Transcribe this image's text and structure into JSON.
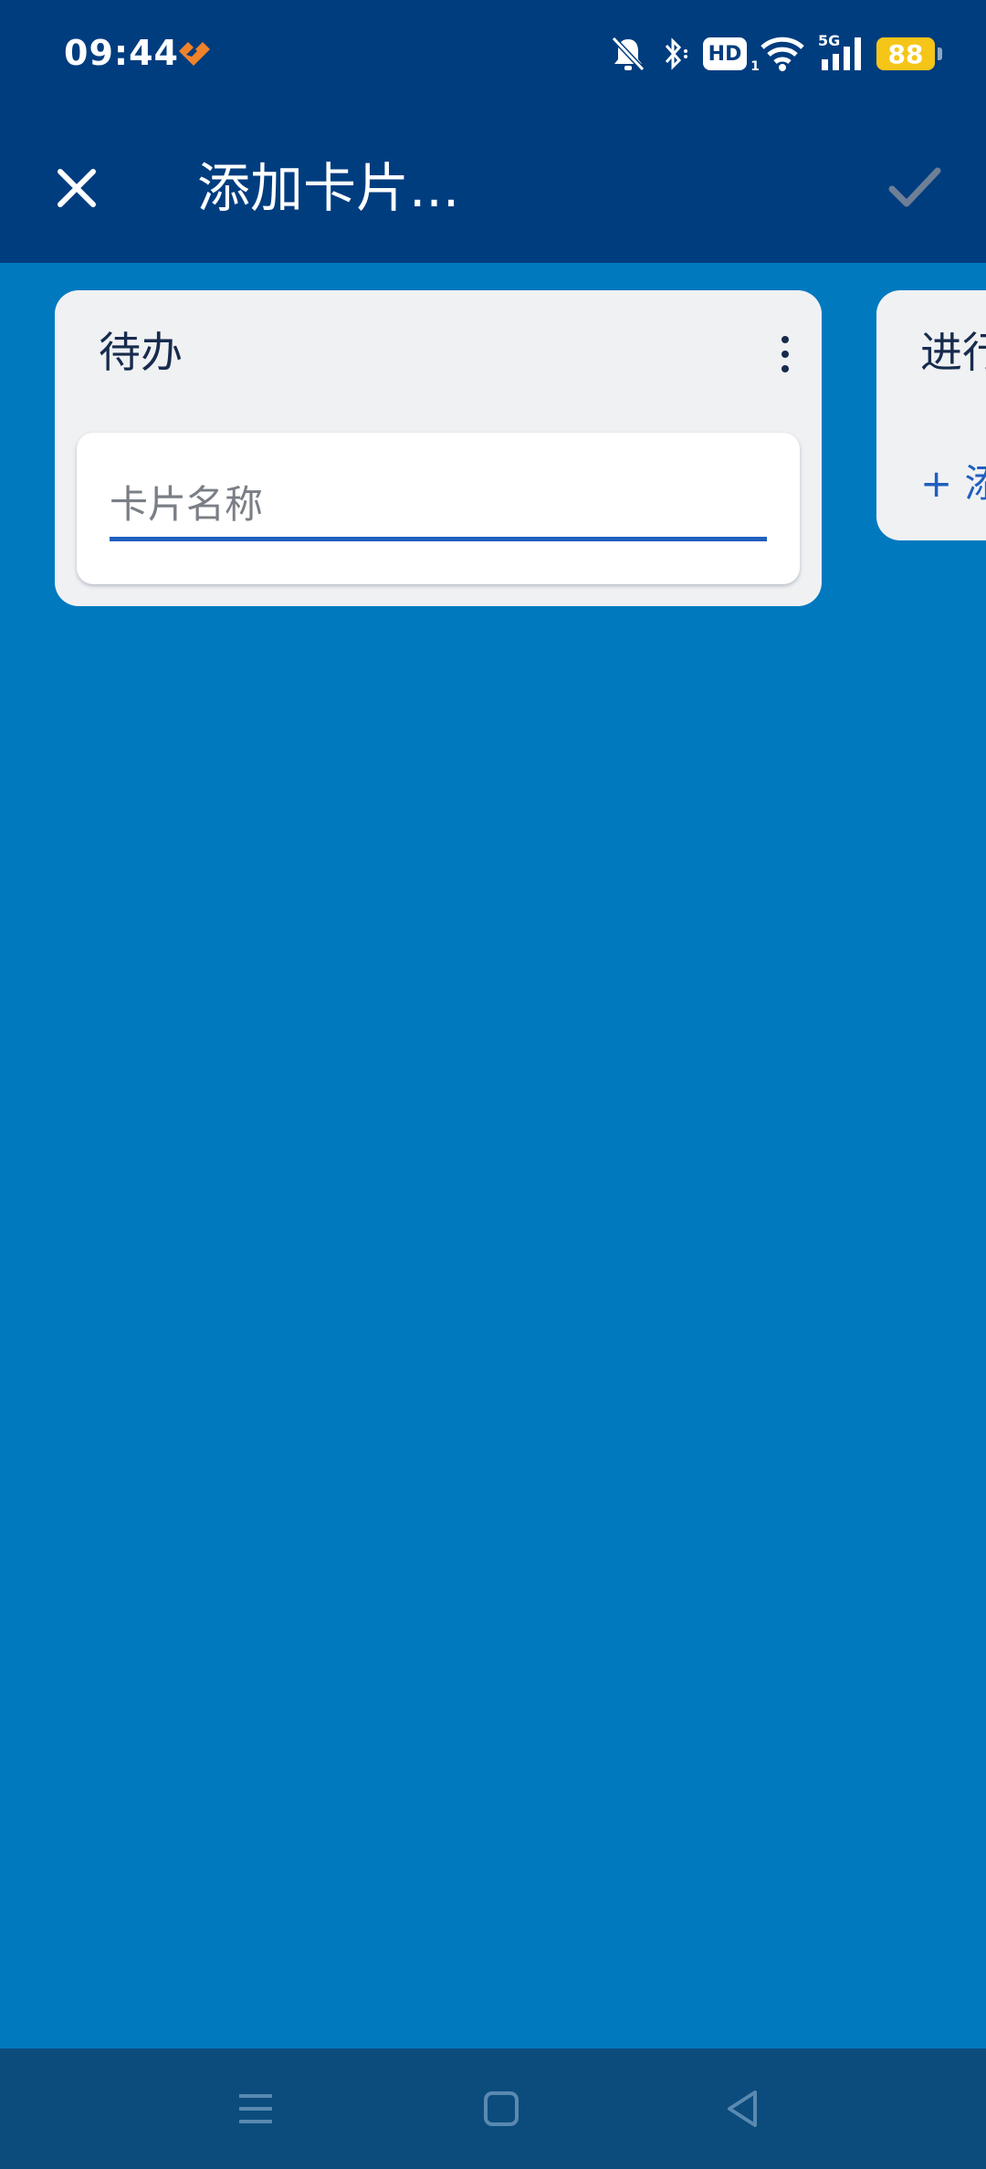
{
  "status_bar": {
    "time": "09:44",
    "hd_label": "HD",
    "hd_sub": "1",
    "network_label": "5G",
    "battery_level": "88"
  },
  "app_bar": {
    "title": "添加卡片...",
    "close_icon": "close-icon",
    "confirm_icon": "check-icon"
  },
  "board": {
    "lists": [
      {
        "title": "待办",
        "new_card_placeholder": "卡片名称",
        "new_card_value": ""
      },
      {
        "title": "进行中",
        "add_card_label": "+ 添加卡片"
      }
    ]
  },
  "nav_bar": {
    "icons": [
      "menu-icon",
      "home-icon",
      "back-icon"
    ]
  },
  "colors": {
    "status_bar_bg": "#003D7F",
    "board_bg": "#0079BF",
    "list_bg": "#F0F1F3",
    "accent": "#1F5FBF",
    "battery": "#F5C518",
    "nav_bar_bg": "#0B4C7D"
  }
}
